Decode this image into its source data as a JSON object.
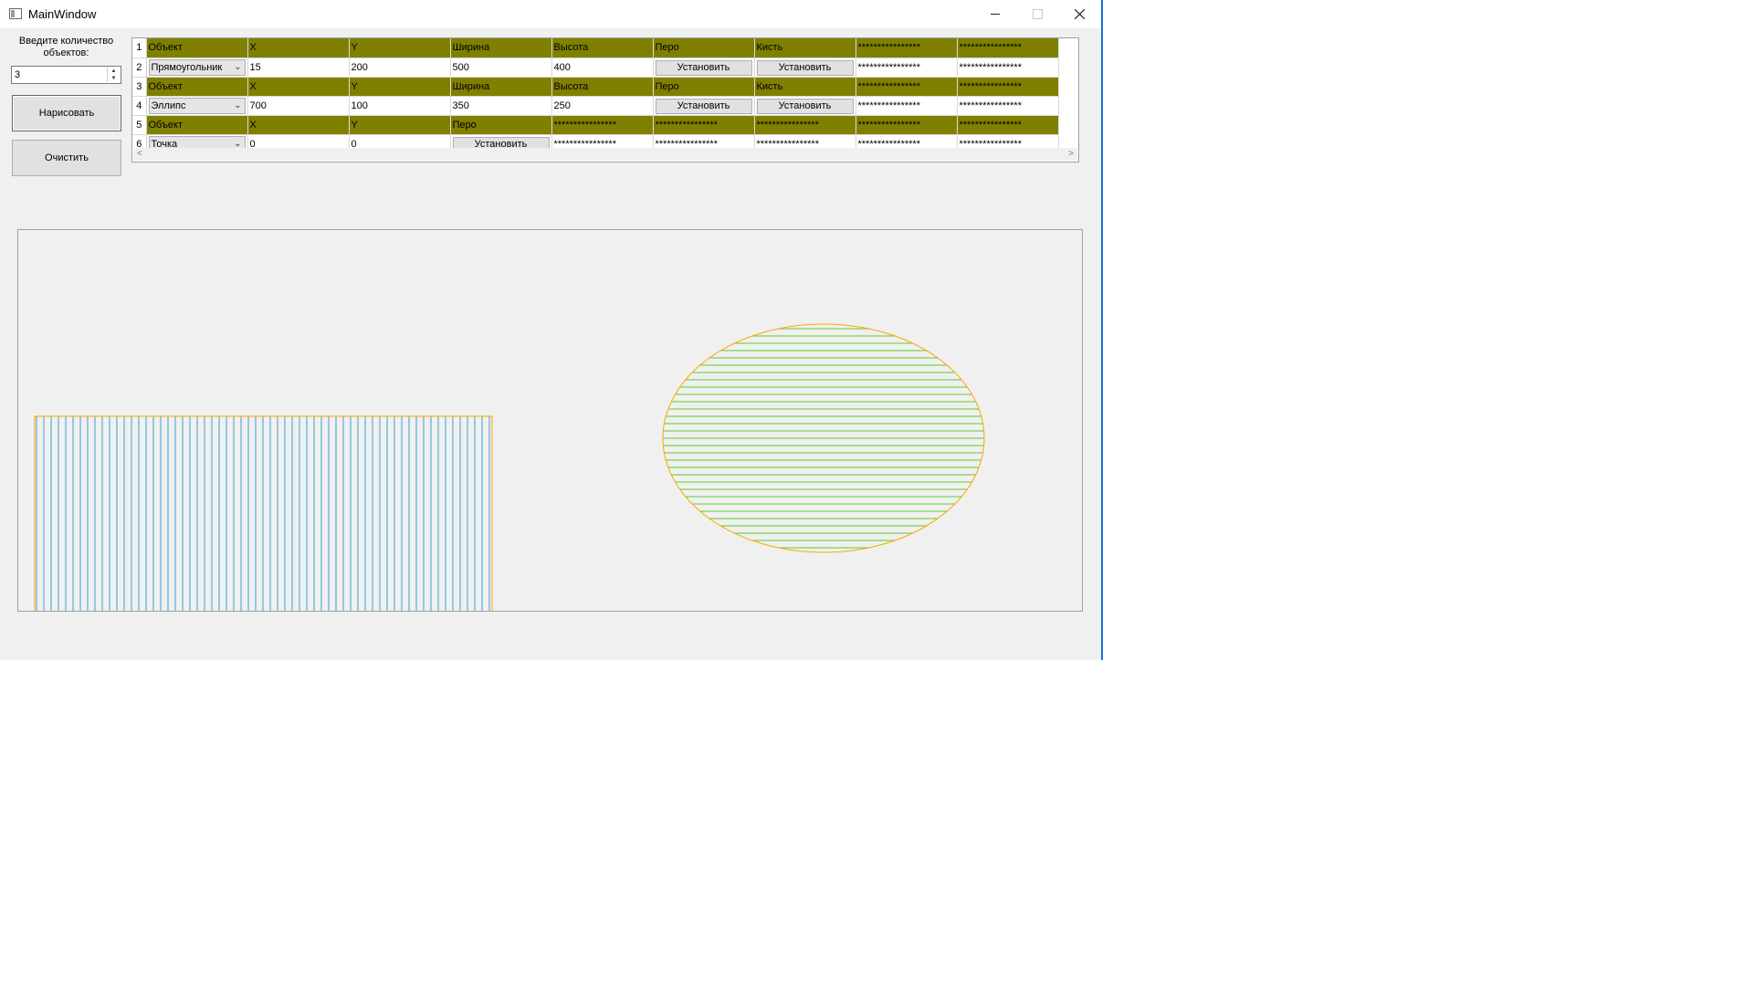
{
  "window": {
    "title": "MainWindow"
  },
  "controls": {
    "count_prompt": "Введите количество объектов:",
    "count_value": "3",
    "spin_up": "▲",
    "spin_down": "▼",
    "draw_button": "Нарисовать",
    "clear_button": "Очистить"
  },
  "table": {
    "row_numbers": [
      "1",
      "2",
      "3",
      "4",
      "5",
      "6"
    ],
    "rows": [
      [
        "Объект",
        "X",
        "Y",
        "Ширина",
        "Высота",
        "Перо",
        "Кисть",
        "****************",
        "****************"
      ],
      [
        "Прямоугольник",
        "15",
        "200",
        "500",
        "400",
        "Установить",
        "Установить",
        "****************",
        "****************"
      ],
      [
        "Объект",
        "X",
        "Y",
        "Ширина",
        "Высота",
        "Перо",
        "Кисть",
        "****************",
        "****************"
      ],
      [
        "Эллипс",
        "700",
        "100",
        "350",
        "250",
        "Установить",
        "Установить",
        "****************",
        "****************"
      ],
      [
        "Объект",
        "X",
        "Y",
        "Перо",
        "****************",
        "****************",
        "****************",
        "****************",
        "****************"
      ],
      [
        "Точка",
        "0",
        "0",
        "Установить",
        "****************",
        "****************",
        "****************",
        "****************",
        "****************"
      ]
    ],
    "scroll_left": "<",
    "scroll_right": ">"
  },
  "colors": {
    "header_bg": "#808000",
    "rect_pen": "#ffa500",
    "rect_hatch": "#3aa0d0",
    "ellipse_pen": "#ffa500",
    "ellipse_hatch": "#5ccc2a",
    "window_border": "#1a74d8"
  }
}
